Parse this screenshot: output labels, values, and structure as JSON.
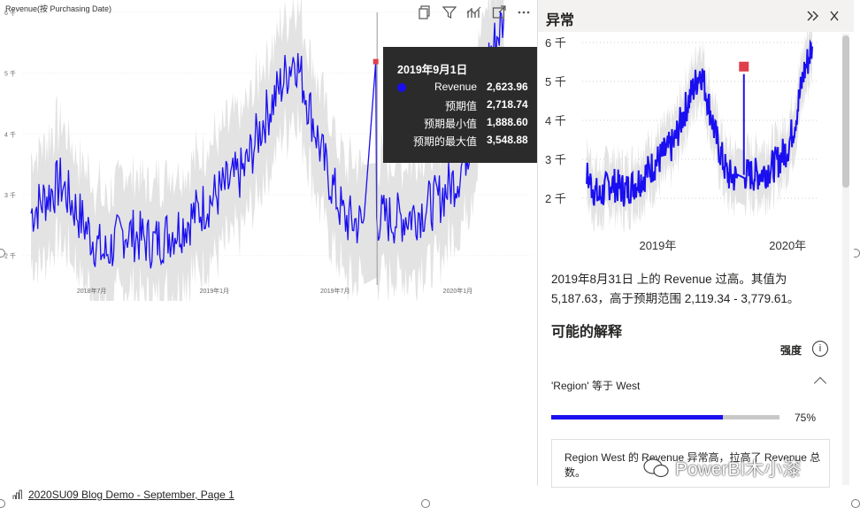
{
  "main_chart": {
    "title": "Revenue(按 Purchasing Date)",
    "chart_data": {
      "type": "line",
      "series": [
        {
          "name": "Revenue",
          "color": "#1a0ff0",
          "x": [
            "2018-04-01",
            "2018-05-15",
            "2018-07-01",
            "2018-07-20",
            "2018-08-20",
            "2018-10-01",
            "2018-11-15",
            "2018-12-15",
            "2019-01-15",
            "2019-02-15",
            "2019-03-15",
            "2019-04-15",
            "2019-05-01",
            "2019-05-15",
            "2019-06-15",
            "2019-07-15",
            "2019-08-15",
            "2019-08-31",
            "2019-09-02",
            "2019-10-01",
            "2019-11-01",
            "2019-12-01",
            "2020-01-01",
            "2020-01-20",
            "2020-02-15",
            "2020-03-10"
          ],
          "values": [
            2700,
            3200,
            2300,
            2000,
            2400,
            2200,
            2500,
            2800,
            3100,
            3400,
            4200,
            4900,
            5300,
            4800,
            3500,
            2600,
            2500,
            5190,
            2620,
            2600,
            2700,
            2900,
            3300,
            3900,
            5200,
            5900
          ]
        },
        {
          "name": "预期值",
          "color": "#d9d9d9"
        }
      ],
      "ylim": [
        1500,
        6000
      ],
      "yticks": [
        "2 千",
        "3 千",
        "4 千",
        "5 千",
        "6 千"
      ],
      "xticks": [
        "2018年7月",
        "2019年1月",
        "2019年7月",
        "2020年1月"
      ]
    },
    "tooltip": {
      "title": "2019年9月1日",
      "rows": [
        {
          "label": "Revenue",
          "value": "2,623.96"
        },
        {
          "label": "预期值",
          "value": "2,718.74"
        },
        {
          "label": "预期最小值",
          "value": "1,888.60"
        },
        {
          "label": "预期的最大值",
          "value": "3,548.88"
        }
      ]
    },
    "anomaly_color": "#e0404b"
  },
  "toolbar": {
    "icons": [
      "copy-icon",
      "filter-icon",
      "analyze-icon",
      "focus-mode-icon",
      "more-options-icon"
    ]
  },
  "anomaly_panel": {
    "title": "异常",
    "mini_chart": {
      "chart_data": {
        "type": "line",
        "yticks": [
          "2 千",
          "3 千",
          "4 千",
          "5 千",
          "6 千"
        ],
        "xticks": [
          "2019年",
          "2020年"
        ],
        "ylim": [
          1500,
          6000
        ],
        "anomaly_value": 5187.63
      }
    },
    "description": "2019年8月31日 上的 Revenue 过高。其值为 5,187.63，高于预期范围 2,119.34 - 3,779.61。",
    "explanations_heading": "可能的解释",
    "strength_label": "强度",
    "factor": "'Region' 等于 West",
    "strength_percent": 75,
    "strength_text": "75%",
    "card_text": "Region West 的 Revenue 异常高，拉高了 Revenue 总数。"
  },
  "watermark": "PowerBI木小漆",
  "footer": {
    "page_link": "2020SU09 Blog Demo - September, Page 1"
  },
  "colors": {
    "accent": "#1a0ff0",
    "band": "#e3e3e3",
    "tooltip_bg": "#2b2b2b"
  }
}
